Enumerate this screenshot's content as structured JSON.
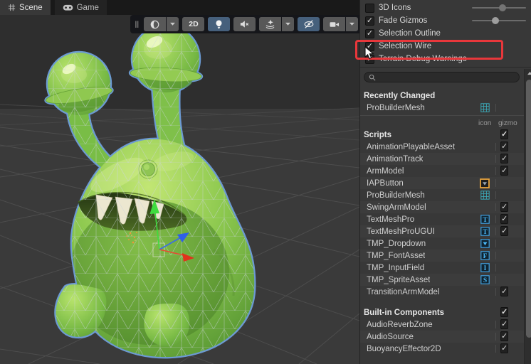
{
  "window": {
    "tabs": [
      {
        "label": "Scene",
        "icon": "grid-icon",
        "active": true
      },
      {
        "label": "Game",
        "icon": "gamepad-icon",
        "active": false
      }
    ]
  },
  "toolbar": {
    "buttons": [
      {
        "name": "shading-mode",
        "icon": "sphere",
        "label": "",
        "dropdown": true,
        "active": false
      },
      {
        "name": "2d-toggle",
        "icon": "",
        "label": "2D",
        "dropdown": false,
        "active": false
      },
      {
        "name": "lighting-toggle",
        "icon": "bulb",
        "label": "",
        "dropdown": false,
        "active": true
      },
      {
        "name": "audio-toggle",
        "icon": "speaker-muted",
        "label": "",
        "dropdown": false,
        "active": false
      },
      {
        "name": "effects-toggle",
        "icon": "effects-star",
        "label": "",
        "dropdown": true,
        "active": false
      },
      {
        "name": "hidden-objects-toggle",
        "icon": "eye-slash",
        "label": "",
        "dropdown": false,
        "active": true
      },
      {
        "name": "camera-menu",
        "icon": "camera",
        "label": "",
        "dropdown": true,
        "active": false
      },
      {
        "name": "gizmos-menu",
        "icon": "gizmo-sphere",
        "label": "",
        "dropdown": true,
        "active": false
      }
    ]
  },
  "gizmos_panel": {
    "toggles": [
      {
        "label": "3D Icons",
        "checked": false,
        "slider": 0.58,
        "slider_dim": true
      },
      {
        "label": "Fade Gizmos",
        "checked": true,
        "slider": 0.42,
        "slider_dim": false
      },
      {
        "label": "Selection Outline",
        "checked": true
      },
      {
        "label": "Selection Wire",
        "checked": true,
        "highlighted": true
      },
      {
        "label": "Terrain Debug Warnings",
        "checked": true
      }
    ],
    "search": {
      "placeholder": "",
      "value": ""
    },
    "columns": {
      "icon": "icon",
      "gizmo": "gizmo"
    },
    "recently_changed": {
      "header": "Recently Changed",
      "rows": [
        {
          "name": "ProBuilderMesh",
          "icon": "probuilder-grid",
          "gizmo": null
        }
      ]
    },
    "sections": [
      {
        "header": "Scripts",
        "header_gizmo": true,
        "rows": [
          {
            "name": "AnimationPlayableAsset",
            "icon": null,
            "gizmo": true
          },
          {
            "name": "AnimationTrack",
            "icon": null,
            "gizmo": true
          },
          {
            "name": "ArmModel",
            "icon": null,
            "gizmo": true
          },
          {
            "name": "IAPButton",
            "icon": "iap-button",
            "gizmo": null
          },
          {
            "name": "ProBuilderMesh",
            "icon": "probuilder-grid",
            "gizmo": null
          },
          {
            "name": "SwingArmModel",
            "icon": null,
            "gizmo": true
          },
          {
            "name": "TextMeshPro",
            "icon": "tmp-t",
            "gizmo": true
          },
          {
            "name": "TextMeshProUGUI",
            "icon": "tmp-t",
            "gizmo": true
          },
          {
            "name": "TMP_Dropdown",
            "icon": "tmp-dropdown",
            "gizmo": null
          },
          {
            "name": "TMP_FontAsset",
            "icon": "tmp-f",
            "gizmo": null
          },
          {
            "name": "TMP_InputField",
            "icon": "tmp-i",
            "gizmo": null
          },
          {
            "name": "TMP_SpriteAsset",
            "icon": "tmp-s",
            "gizmo": null
          },
          {
            "name": "TransitionArmModel",
            "icon": null,
            "gizmo": true
          }
        ]
      },
      {
        "header": "Built-in Components",
        "header_gizmo": true,
        "rows": [
          {
            "name": "AudioReverbZone",
            "icon": null,
            "gizmo": true
          },
          {
            "name": "AudioSource",
            "icon": null,
            "gizmo": true
          },
          {
            "name": "BuoyancyEffector2D",
            "icon": null,
            "gizmo": true
          }
        ]
      }
    ]
  },
  "annotation": {
    "highlight_target": "Selection Wire",
    "highlight_color": "#e8373b"
  },
  "colors": {
    "active_button": "#46607c",
    "selection_outline": "#6fa0dc",
    "axis_x_red": "#e0321c",
    "axis_y_green": "#3fdc3f",
    "axis_z_blue": "#2f5fe8",
    "tmp_icon_blue": "#49b5f2",
    "probuilder_icon_teal": "#3ba6b4",
    "iap_icon_border": "#e8a33d"
  }
}
